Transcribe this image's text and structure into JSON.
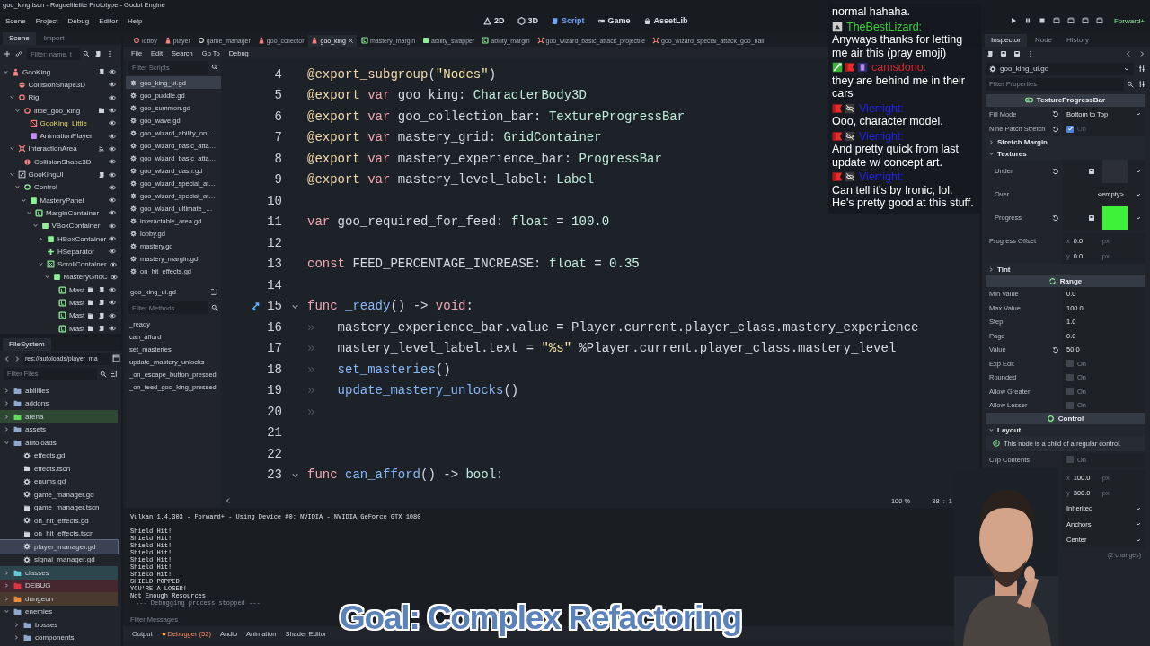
{
  "window": {
    "title": "goo_king.tscn - Roguelitelite Prototype - Godot Engine"
  },
  "menu": [
    "Scene",
    "Project",
    "Debug",
    "Editor",
    "Help"
  ],
  "workspaces": [
    {
      "label": "2D",
      "kind": "plane",
      "selected": false
    },
    {
      "label": "3D",
      "kind": "cube",
      "selected": false
    },
    {
      "label": "Script",
      "kind": "script",
      "selected": true
    },
    {
      "label": "Game",
      "kind": "game",
      "selected": false
    },
    {
      "label": "AssetLib",
      "kind": "store",
      "selected": false
    }
  ],
  "renderer": "Forward+",
  "scene_dock": {
    "tabs": [
      {
        "label": "Scene",
        "selected": true
      },
      {
        "label": "Import",
        "selected": false
      }
    ],
    "filter": {
      "placeholder": "Filter: name, t"
    },
    "tree": [
      {
        "label": "GooKing",
        "kind": "body3d",
        "expanded": true,
        "script": true,
        "visible": true,
        "children": [
          {
            "label": "CollisionShape3D",
            "kind": "collision",
            "visible": true
          },
          {
            "label": "Rig",
            "kind": "node3d",
            "expanded": true,
            "visible": true,
            "children": [
              {
                "label": "little_goo_king",
                "kind": "node3d",
                "expanded": true,
                "scene": true,
                "visible": true,
                "children": [
                  {
                    "label": "GooKing_Little",
                    "kind": "mesh",
                    "instance": true,
                    "visible": true
                  },
                  {
                    "label": "AnimationPlayer",
                    "kind": "anim",
                    "visible": true
                  }
                ]
              }
            ]
          },
          {
            "label": "InteractionArea",
            "kind": "area",
            "expanded": true,
            "signals": true,
            "visible": true,
            "children": [
              {
                "label": "CollisionShape3D",
                "kind": "collision",
                "visible": true
              }
            ]
          },
          {
            "label": "GooKingUI",
            "kind": "canvas",
            "expanded": true,
            "script": true,
            "visible": true,
            "children": [
              {
                "label": "Control",
                "kind": "control",
                "expanded": true,
                "visible": true,
                "children": [
                  {
                    "label": "MasteryPanel",
                    "kind": "panel",
                    "expanded": true,
                    "visible": true,
                    "children": [
                      {
                        "label": "MarginContainer",
                        "kind": "margin",
                        "expanded": true,
                        "visible": true,
                        "children": [
                          {
                            "label": "VBoxContainer",
                            "kind": "panel",
                            "expanded": true,
                            "visible": true,
                            "children": [
                              {
                                "label": "HBoxContainer",
                                "kind": "panel",
                                "expanded": false,
                                "visible": true
                              },
                              {
                                "label": "HSeparator",
                                "kind": "separator",
                                "visible": true
                              },
                              {
                                "label": "ScrollContainer",
                                "kind": "scroll",
                                "expanded": true,
                                "visible": true,
                                "children": [
                                  {
                                    "label": "MasteryGridC",
                                    "kind": "panel",
                                    "expanded": true,
                                    "visible": true,
                                    "children": [
                                      {
                                        "label": "Mast",
                                        "kind": "margin",
                                        "scene": true,
                                        "script": true,
                                        "visible": true
                                      },
                                      {
                                        "label": "Mast",
                                        "kind": "margin",
                                        "scene": true,
                                        "script": true,
                                        "visible": true
                                      },
                                      {
                                        "label": "Mast",
                                        "kind": "margin",
                                        "scene": true,
                                        "script": true,
                                        "visible": true
                                      },
                                      {
                                        "label": "Mast",
                                        "kind": "margin",
                                        "scene": true,
                                        "script": true,
                                        "visible": true
                                      }
                                    ]
                                  }
                                ]
                              }
                            ]
                          }
                        ]
                      }
                    ]
                  }
                ]
              }
            ]
          }
        ]
      }
    ]
  },
  "filesystem": {
    "title": "FileSystem",
    "path": "res://autoloads/player_ma",
    "filter": {
      "placeholder": "Filter Files"
    },
    "tree": [
      {
        "label": "abilities",
        "kind": "folder",
        "expanded": false
      },
      {
        "label": "addons",
        "kind": "folder",
        "expanded": false
      },
      {
        "label": "arena",
        "kind": "folder",
        "color": "#63d95a",
        "expanded": false
      },
      {
        "label": "assets",
        "kind": "folder",
        "expanded": false
      },
      {
        "label": "autoloads",
        "kind": "folder",
        "expanded": true,
        "children": [
          {
            "label": "effects.gd",
            "kind": "script",
            "selected": false
          },
          {
            "label": "effects.tscn",
            "kind": "scene",
            "selected": false
          },
          {
            "label": "enums.gd",
            "kind": "script",
            "selected": false
          },
          {
            "label": "game_manager.gd",
            "kind": "script",
            "selected": false
          },
          {
            "label": "game_manager.tscn",
            "kind": "scene",
            "selected": false
          },
          {
            "label": "on_hit_effects.gd",
            "kind": "script",
            "selected": false
          },
          {
            "label": "on_hit_effects.tscn",
            "kind": "scene",
            "selected": false
          },
          {
            "label": "player_manager.gd",
            "kind": "script",
            "selected": true
          },
          {
            "label": "signal_manager.gd",
            "kind": "script",
            "selected": false
          }
        ]
      },
      {
        "label": "classes",
        "kind": "folder",
        "color": "#5fc9d6",
        "expanded": false
      },
      {
        "label": "DEBUG",
        "kind": "folder",
        "color": "#e0343f",
        "expanded": false
      },
      {
        "label": "dungeon",
        "kind": "folder",
        "color": "#ee8c3c",
        "expanded": false
      },
      {
        "label": "enemies",
        "kind": "folder",
        "expanded": true,
        "children": [
          {
            "label": "bosses",
            "kind": "folder",
            "expanded": false
          },
          {
            "label": "components",
            "kind": "folder",
            "expanded": false
          }
        ]
      }
    ]
  },
  "script_tabs": [
    {
      "label": "lobby",
      "kind": "node3d",
      "selected": false
    },
    {
      "label": "player",
      "kind": "body3d",
      "selected": false
    },
    {
      "label": "game_manager",
      "kind": "node",
      "selected": false
    },
    {
      "label": "goo_collector",
      "kind": "body3d",
      "selected": false
    },
    {
      "label": "goo_king",
      "kind": "body3d",
      "selected": true
    },
    {
      "label": "mastery_margin",
      "kind": "margin",
      "selected": false
    },
    {
      "label": "ability_swapper",
      "kind": "panel",
      "selected": false
    },
    {
      "label": "ability_margin",
      "kind": "margin",
      "selected": false
    },
    {
      "label": "goo_wizard_basic_attack_projectile",
      "kind": "area",
      "selected": false
    },
    {
      "label": "goo_wizard_special_attack_goo_ball",
      "kind": "area",
      "selected": false
    }
  ],
  "script_panel": {
    "menu": [
      "File",
      "Edit",
      "Search",
      "Go To",
      "Debug"
    ],
    "filter_scripts": {
      "placeholder": "Filter Scripts"
    },
    "scripts": [
      {
        "label": "goo_king_ui.gd",
        "selected": true
      },
      {
        "label": "goo_puddle.gd",
        "selected": false
      },
      {
        "label": "goo_summon.gd",
        "selected": false
      },
      {
        "label": "goo_wave.gd",
        "selected": false
      },
      {
        "label": "goo_wizard_ability_on…",
        "selected": false
      },
      {
        "label": "goo_wizard_basic_atta…",
        "selected": false
      },
      {
        "label": "goo_wizard_basic_atta…",
        "selected": false
      },
      {
        "label": "goo_wizard_dash.gd",
        "selected": false
      },
      {
        "label": "goo_wizard_special_at…",
        "selected": false
      },
      {
        "label": "goo_wizard_special_at…",
        "selected": false
      },
      {
        "label": "goo_wizard_ultimate_…",
        "selected": false
      },
      {
        "label": "interactable_area.gd",
        "selected": false
      },
      {
        "label": "lobby.gd",
        "selected": false
      },
      {
        "label": "mastery.gd",
        "selected": false
      },
      {
        "label": "mastery_margin.gd",
        "selected": false
      },
      {
        "label": "on_hit_effects.gd",
        "selected": false
      }
    ],
    "current": "goo_king_ui.gd",
    "filter_methods": {
      "placeholder": "Filter Methods"
    },
    "methods": [
      "_ready",
      "can_afford",
      "set_masteries",
      "update_mastery_unlocks",
      "_on_escape_button_pressed",
      "_on_feed_goo_king_pressed"
    ]
  },
  "code": {
    "lines": [
      {
        "number": "4",
        "tokens": [
          {
            "kind": "ann",
            "text": "@export_subgroup"
          },
          {
            "kind": "sym",
            "text": "("
          },
          {
            "kind": "str",
            "text": "\"Nodes\""
          },
          {
            "kind": "sym",
            "text": ")"
          }
        ]
      },
      {
        "number": "5",
        "tokens": [
          {
            "kind": "ann",
            "text": "@export"
          },
          {
            "kind": "kw",
            "text": " var"
          },
          {
            "kind": "txt",
            "text": " goo_king"
          },
          {
            "kind": "sym",
            "text": ": "
          },
          {
            "kind": "type",
            "text": "CharacterBody3D"
          }
        ]
      },
      {
        "number": "6",
        "tokens": [
          {
            "kind": "ann",
            "text": "@export"
          },
          {
            "kind": "kw",
            "text": " var"
          },
          {
            "kind": "txt",
            "text": " goo_collection_bar"
          },
          {
            "kind": "sym",
            "text": ": "
          },
          {
            "kind": "type",
            "text": "TextureProgressBar"
          }
        ]
      },
      {
        "number": "7",
        "tokens": [
          {
            "kind": "ann",
            "text": "@export"
          },
          {
            "kind": "kw",
            "text": " var"
          },
          {
            "kind": "txt",
            "text": " mastery_grid"
          },
          {
            "kind": "sym",
            "text": ": "
          },
          {
            "kind": "type",
            "text": "GridContainer"
          }
        ]
      },
      {
        "number": "8",
        "tokens": [
          {
            "kind": "ann",
            "text": "@export"
          },
          {
            "kind": "kw",
            "text": " var"
          },
          {
            "kind": "txt",
            "text": " mastery_experience_bar"
          },
          {
            "kind": "sym",
            "text": ": "
          },
          {
            "kind": "type",
            "text": "ProgressBar"
          }
        ]
      },
      {
        "number": "9",
        "tokens": [
          {
            "kind": "ann",
            "text": "@export"
          },
          {
            "kind": "kw",
            "text": " var"
          },
          {
            "kind": "txt",
            "text": " mastery_level_label"
          },
          {
            "kind": "sym",
            "text": ": "
          },
          {
            "kind": "type",
            "text": "Label"
          }
        ]
      },
      {
        "number": "10"
      },
      {
        "number": "11",
        "tokens": [
          {
            "kind": "kw",
            "text": "var"
          },
          {
            "kind": "txt",
            "text": " goo_required_for_feed"
          },
          {
            "kind": "sym",
            "text": ": "
          },
          {
            "kind": "type",
            "text": "float"
          },
          {
            "kind": "sym",
            "text": " = "
          },
          {
            "kind": "num",
            "text": "100.0"
          }
        ]
      },
      {
        "number": "12"
      },
      {
        "number": "13",
        "tokens": [
          {
            "kind": "kw",
            "text": "const"
          },
          {
            "kind": "txt",
            "text": " FEED_PERCENTAGE_INCREASE"
          },
          {
            "kind": "sym",
            "text": ": "
          },
          {
            "kind": "type",
            "text": "float"
          },
          {
            "kind": "sym",
            "text": " = "
          },
          {
            "kind": "num",
            "text": "0.35"
          }
        ]
      },
      {
        "number": "14"
      },
      {
        "number": "15",
        "signal": true,
        "foldable": true,
        "tokens": [
          {
            "kind": "kw",
            "text": "func"
          },
          {
            "kind": "fn",
            "text": " _ready"
          },
          {
            "kind": "sym",
            "text": "() -> "
          },
          {
            "kind": "kw",
            "text": "void"
          },
          {
            "kind": "sym",
            "text": ":"
          }
        ]
      },
      {
        "number": "16",
        "tokens": [
          {
            "kind": "tab",
            "text": "»"
          },
          {
            "kind": "txt",
            "text": "mastery_experience_bar.value = Player.current.player_class.mastery_experience"
          }
        ]
      },
      {
        "number": "17",
        "tokens": [
          {
            "kind": "tab",
            "text": "»"
          },
          {
            "kind": "txt",
            "text": "mastery_level_label.text = "
          },
          {
            "kind": "str",
            "text": "\"%s\""
          },
          {
            "kind": "txt",
            "text": " %Player.current.player_class.mastery_level"
          }
        ]
      },
      {
        "number": "18",
        "tokens": [
          {
            "kind": "tab",
            "text": "»"
          },
          {
            "kind": "fn",
            "text": "set_masteries"
          },
          {
            "kind": "sym",
            "text": "()"
          }
        ]
      },
      {
        "number": "19",
        "tokens": [
          {
            "kind": "tab",
            "text": "»"
          },
          {
            "kind": "fn",
            "text": "update_mastery_unlocks"
          },
          {
            "kind": "sym",
            "text": "()"
          }
        ]
      },
      {
        "number": "20",
        "tokens": [
          {
            "kind": "tab",
            "text": "»"
          }
        ]
      },
      {
        "number": "21"
      },
      {
        "number": "22"
      },
      {
        "number": "23",
        "foldable": true,
        "tokens": [
          {
            "kind": "kw",
            "text": "func"
          },
          {
            "kind": "fn",
            "text": " can_afford"
          },
          {
            "kind": "sym",
            "text": "() -> "
          },
          {
            "kind": "type",
            "text": "bool"
          },
          {
            "kind": "sym",
            "text": ":"
          }
        ]
      }
    ],
    "zoom": "100 %",
    "position": "38 : 1"
  },
  "output": {
    "lines": [
      {
        "kind": "info",
        "text": "Vulkan 1.4.303 - Forward+ - Using Device #0: NVIDIA - NVIDIA GeForce GTX 1080"
      },
      {
        "kind": "log",
        "text": "Shield Hit!"
      },
      {
        "kind": "log",
        "text": "Shield Hit!"
      },
      {
        "kind": "log",
        "text": "Shield Hit!"
      },
      {
        "kind": "log",
        "text": "Shield Hit!"
      },
      {
        "kind": "log",
        "text": "Shield Hit!"
      },
      {
        "kind": "log",
        "text": "Shield Hit!"
      },
      {
        "kind": "log",
        "text": "Shield Hit!"
      },
      {
        "kind": "log",
        "text": "SHIELD POPPED!"
      },
      {
        "kind": "log",
        "text": "YOU'RE A LOSER!"
      },
      {
        "kind": "log",
        "text": "Not Enough Resources"
      },
      {
        "kind": "dim",
        "text": "--- Debugging process stopped ---"
      }
    ],
    "filter": {
      "placeholder": "Filter Messages"
    }
  },
  "bottom_tabs": [
    {
      "label": "Output",
      "selected": false,
      "alert": false
    },
    {
      "label": "Debugger (52)",
      "selected": false,
      "alert": true
    },
    {
      "label": "Audio",
      "selected": false,
      "alert": false
    },
    {
      "label": "Animation",
      "selected": false,
      "alert": false
    },
    {
      "label": "Shader Editor",
      "selected": false,
      "alert": false
    }
  ],
  "inspector": {
    "tabs": [
      {
        "label": "Inspector",
        "selected": true
      },
      {
        "label": "Node",
        "selected": false
      },
      {
        "label": "History",
        "selected": false
      }
    ],
    "resource": "goo_king_ui.gd",
    "filter": {
      "placeholder": "Filter Properties"
    },
    "items": [
      {
        "kind": "header",
        "label": "TextureProgressBar"
      },
      {
        "kind": "option",
        "label": "Fill Mode",
        "revert": true,
        "value": "Bottom to Top"
      },
      {
        "kind": "check",
        "label": "Nine Patch Stretch",
        "revert": true,
        "checked": true,
        "text": "On"
      },
      {
        "kind": "group",
        "label": "Stretch Margin",
        "expanded": false
      },
      {
        "kind": "group",
        "label": "Textures",
        "expanded": true
      },
      {
        "kind": "texture",
        "label": "Under",
        "revert": true,
        "color": "#2c2f35"
      },
      {
        "kind": "texture",
        "label": "Over",
        "value": "<empty>"
      },
      {
        "kind": "texture",
        "label": "Progress",
        "revert": true,
        "color": "#3ef23a"
      },
      {
        "kind": "vector",
        "label": "Progress Offset",
        "components": [
          {
            "axis": "x",
            "value": "0.0",
            "unit": "px"
          },
          {
            "axis": "y",
            "value": "0.0",
            "unit": "px"
          }
        ]
      },
      {
        "kind": "group",
        "label": "Tint",
        "expanded": false
      },
      {
        "kind": "header",
        "label": "Range"
      },
      {
        "kind": "value",
        "label": "Min Value",
        "value": "0.0"
      },
      {
        "kind": "value",
        "label": "Max Value",
        "value": "100.0"
      },
      {
        "kind": "value",
        "label": "Step",
        "value": "1.0"
      },
      {
        "kind": "value",
        "label": "Page",
        "value": "0.0"
      },
      {
        "kind": "value",
        "label": "Value",
        "revert": true,
        "value": "50.0"
      },
      {
        "kind": "check",
        "label": "Exp Edit",
        "checked": false,
        "text": "On"
      },
      {
        "kind": "check",
        "label": "Rounded",
        "checked": false,
        "text": "On"
      },
      {
        "kind": "check",
        "label": "Allow Greater",
        "checked": false,
        "text": "On"
      },
      {
        "kind": "check",
        "label": "Allow Lesser",
        "checked": false,
        "text": "On"
      },
      {
        "kind": "header",
        "label": "Control"
      },
      {
        "kind": "group",
        "label": "Layout",
        "expanded": true
      },
      {
        "kind": "note",
        "text": "This node is a child of a regular control."
      },
      {
        "kind": "check",
        "label": "Clip Contents",
        "checked": false,
        "text": "On"
      },
      {
        "kind": "vector",
        "components": [
          {
            "axis": "x",
            "value": "100.0",
            "unit": "px"
          },
          {
            "axis": "y",
            "value": "300.0",
            "unit": "px"
          }
        ]
      },
      {
        "kind": "option",
        "value": "Inherited"
      },
      {
        "kind": "option",
        "value": "Anchors"
      },
      {
        "kind": "option",
        "value": "Center"
      }
    ],
    "changes": "(2 changes)"
  },
  "chat": [
    {
      "text": "normal hahaha."
    },
    {
      "name": "TheBestLizard:",
      "color": "#3ccf3c",
      "badges": [
        {
          "kind": "up"
        }
      ],
      "text": "Anyways thanks for letting me air this (pray emoji)"
    },
    {
      "name": "camsdono:",
      "color": "#d8262c",
      "badges": [
        {
          "kind": "sword"
        },
        {
          "kind": "flag"
        },
        {
          "kind": "pixel"
        }
      ],
      "text": "they are behind me in their cars"
    },
    {
      "name": "Vierright:",
      "color": "#2222e6",
      "badges": [
        {
          "kind": "flag"
        },
        {
          "kind": "eyeoff"
        }
      ],
      "text": "Ooo, character model."
    },
    {
      "name": "Vierright:",
      "color": "#2222e6",
      "badges": [
        {
          "kind": "flag"
        },
        {
          "kind": "eyeoff"
        }
      ],
      "text": "And pretty quick from last update w/ concept art."
    },
    {
      "name": "Vierright:",
      "color": "#2222e6",
      "badges": [
        {
          "kind": "flag"
        },
        {
          "kind": "eyeoff"
        }
      ],
      "text": "Can tell it's by Ironic, lol. He's pretty good at this stuff."
    }
  ],
  "overlay": {
    "goal": "Goal: Complex Refactoring"
  }
}
